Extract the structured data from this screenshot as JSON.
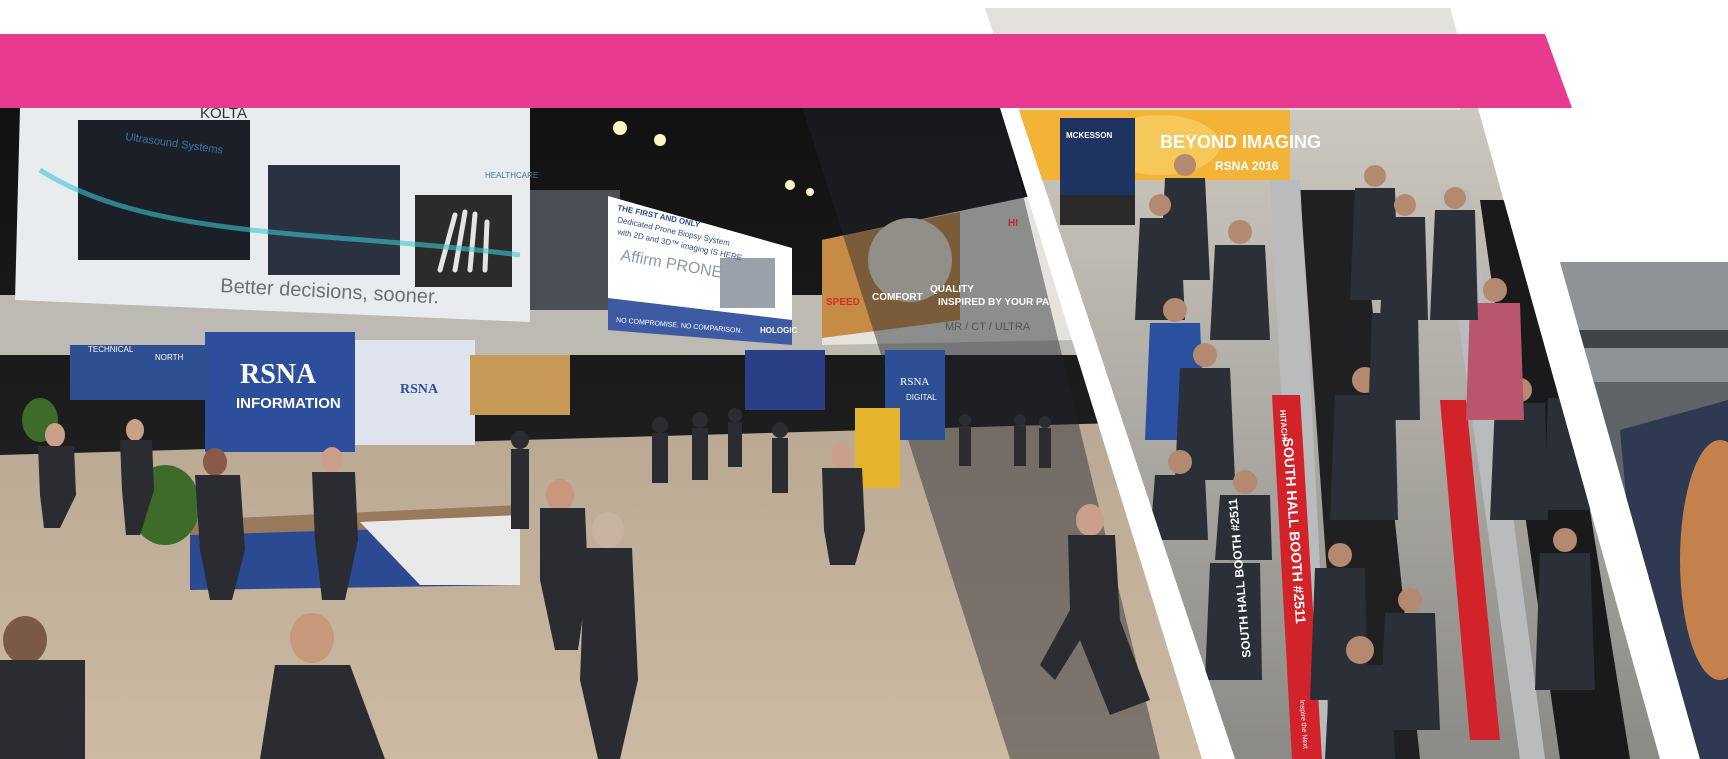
{
  "accent_color": "#e83a8f",
  "panel_left": {
    "banner_brand": "KOLTA",
    "banner_heading": "Ultrasound Systems",
    "banner_tagline": "Better decisions, sooner.",
    "banner_right_label": "HEALTHCARE",
    "center_banner_lines": [
      "THE FIRST AND ONLY",
      "Dedicated Prone Biopsy System",
      "with 2D and 3D™ imaging IS HERE"
    ],
    "center_banner_product": "Affirm PRONE",
    "center_banner_footer": "NO COMPROMISE. NO COMPARISON.",
    "center_banner_brand": "HOLOGIC",
    "right_banner_words": [
      "SPEED",
      "COMFORT",
      "QUALITY"
    ],
    "right_banner_sub": "INSPIRED BY YOUR PA",
    "right_banner_line": "MR / CT / ULTRA",
    "right_banner_badge": "HI",
    "booth_brand": "RSNA",
    "booth_label": "INFORMATION",
    "booth_side_brand": "RSNA",
    "north_sign": "NORTH",
    "technical_sign": "TECHNICAL",
    "digital_sign_brand": "RSNA",
    "digital_sign_text": "DIGITAL"
  },
  "panel_middle": {
    "kiosk_brand": "MCKESSON",
    "banner_text_1": "BEYOND IMAGING",
    "banner_text_2": "RSNA 2016",
    "escalator_sign_1": "SOUTH HALL BOOTH #2511",
    "escalator_sign_2": "SOUTH HALL BOOTH #2511",
    "escalator_brand": "HITACHI",
    "escalator_slogan": "Inspire the Next"
  },
  "panel_right": {
    "description_only": ""
  }
}
